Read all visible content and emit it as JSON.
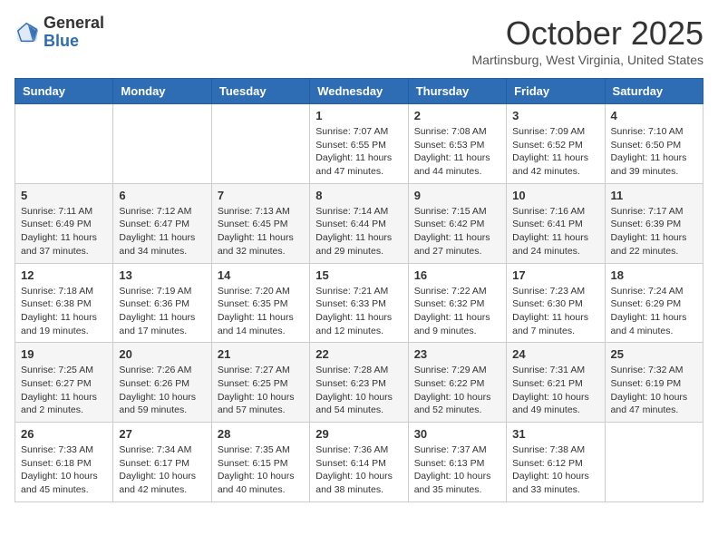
{
  "header": {
    "logo_general": "General",
    "logo_blue": "Blue",
    "month_title": "October 2025",
    "location": "Martinsburg, West Virginia, United States"
  },
  "days_of_week": [
    "Sunday",
    "Monday",
    "Tuesday",
    "Wednesday",
    "Thursday",
    "Friday",
    "Saturday"
  ],
  "weeks": [
    [
      {
        "day": "",
        "info": ""
      },
      {
        "day": "",
        "info": ""
      },
      {
        "day": "",
        "info": ""
      },
      {
        "day": "1",
        "info": "Sunrise: 7:07 AM\nSunset: 6:55 PM\nDaylight: 11 hours and 47 minutes."
      },
      {
        "day": "2",
        "info": "Sunrise: 7:08 AM\nSunset: 6:53 PM\nDaylight: 11 hours and 44 minutes."
      },
      {
        "day": "3",
        "info": "Sunrise: 7:09 AM\nSunset: 6:52 PM\nDaylight: 11 hours and 42 minutes."
      },
      {
        "day": "4",
        "info": "Sunrise: 7:10 AM\nSunset: 6:50 PM\nDaylight: 11 hours and 39 minutes."
      }
    ],
    [
      {
        "day": "5",
        "info": "Sunrise: 7:11 AM\nSunset: 6:49 PM\nDaylight: 11 hours and 37 minutes."
      },
      {
        "day": "6",
        "info": "Sunrise: 7:12 AM\nSunset: 6:47 PM\nDaylight: 11 hours and 34 minutes."
      },
      {
        "day": "7",
        "info": "Sunrise: 7:13 AM\nSunset: 6:45 PM\nDaylight: 11 hours and 32 minutes."
      },
      {
        "day": "8",
        "info": "Sunrise: 7:14 AM\nSunset: 6:44 PM\nDaylight: 11 hours and 29 minutes."
      },
      {
        "day": "9",
        "info": "Sunrise: 7:15 AM\nSunset: 6:42 PM\nDaylight: 11 hours and 27 minutes."
      },
      {
        "day": "10",
        "info": "Sunrise: 7:16 AM\nSunset: 6:41 PM\nDaylight: 11 hours and 24 minutes."
      },
      {
        "day": "11",
        "info": "Sunrise: 7:17 AM\nSunset: 6:39 PM\nDaylight: 11 hours and 22 minutes."
      }
    ],
    [
      {
        "day": "12",
        "info": "Sunrise: 7:18 AM\nSunset: 6:38 PM\nDaylight: 11 hours and 19 minutes."
      },
      {
        "day": "13",
        "info": "Sunrise: 7:19 AM\nSunset: 6:36 PM\nDaylight: 11 hours and 17 minutes."
      },
      {
        "day": "14",
        "info": "Sunrise: 7:20 AM\nSunset: 6:35 PM\nDaylight: 11 hours and 14 minutes."
      },
      {
        "day": "15",
        "info": "Sunrise: 7:21 AM\nSunset: 6:33 PM\nDaylight: 11 hours and 12 minutes."
      },
      {
        "day": "16",
        "info": "Sunrise: 7:22 AM\nSunset: 6:32 PM\nDaylight: 11 hours and 9 minutes."
      },
      {
        "day": "17",
        "info": "Sunrise: 7:23 AM\nSunset: 6:30 PM\nDaylight: 11 hours and 7 minutes."
      },
      {
        "day": "18",
        "info": "Sunrise: 7:24 AM\nSunset: 6:29 PM\nDaylight: 11 hours and 4 minutes."
      }
    ],
    [
      {
        "day": "19",
        "info": "Sunrise: 7:25 AM\nSunset: 6:27 PM\nDaylight: 11 hours and 2 minutes."
      },
      {
        "day": "20",
        "info": "Sunrise: 7:26 AM\nSunset: 6:26 PM\nDaylight: 10 hours and 59 minutes."
      },
      {
        "day": "21",
        "info": "Sunrise: 7:27 AM\nSunset: 6:25 PM\nDaylight: 10 hours and 57 minutes."
      },
      {
        "day": "22",
        "info": "Sunrise: 7:28 AM\nSunset: 6:23 PM\nDaylight: 10 hours and 54 minutes."
      },
      {
        "day": "23",
        "info": "Sunrise: 7:29 AM\nSunset: 6:22 PM\nDaylight: 10 hours and 52 minutes."
      },
      {
        "day": "24",
        "info": "Sunrise: 7:31 AM\nSunset: 6:21 PM\nDaylight: 10 hours and 49 minutes."
      },
      {
        "day": "25",
        "info": "Sunrise: 7:32 AM\nSunset: 6:19 PM\nDaylight: 10 hours and 47 minutes."
      }
    ],
    [
      {
        "day": "26",
        "info": "Sunrise: 7:33 AM\nSunset: 6:18 PM\nDaylight: 10 hours and 45 minutes."
      },
      {
        "day": "27",
        "info": "Sunrise: 7:34 AM\nSunset: 6:17 PM\nDaylight: 10 hours and 42 minutes."
      },
      {
        "day": "28",
        "info": "Sunrise: 7:35 AM\nSunset: 6:15 PM\nDaylight: 10 hours and 40 minutes."
      },
      {
        "day": "29",
        "info": "Sunrise: 7:36 AM\nSunset: 6:14 PM\nDaylight: 10 hours and 38 minutes."
      },
      {
        "day": "30",
        "info": "Sunrise: 7:37 AM\nSunset: 6:13 PM\nDaylight: 10 hours and 35 minutes."
      },
      {
        "day": "31",
        "info": "Sunrise: 7:38 AM\nSunset: 6:12 PM\nDaylight: 10 hours and 33 minutes."
      },
      {
        "day": "",
        "info": ""
      }
    ]
  ]
}
